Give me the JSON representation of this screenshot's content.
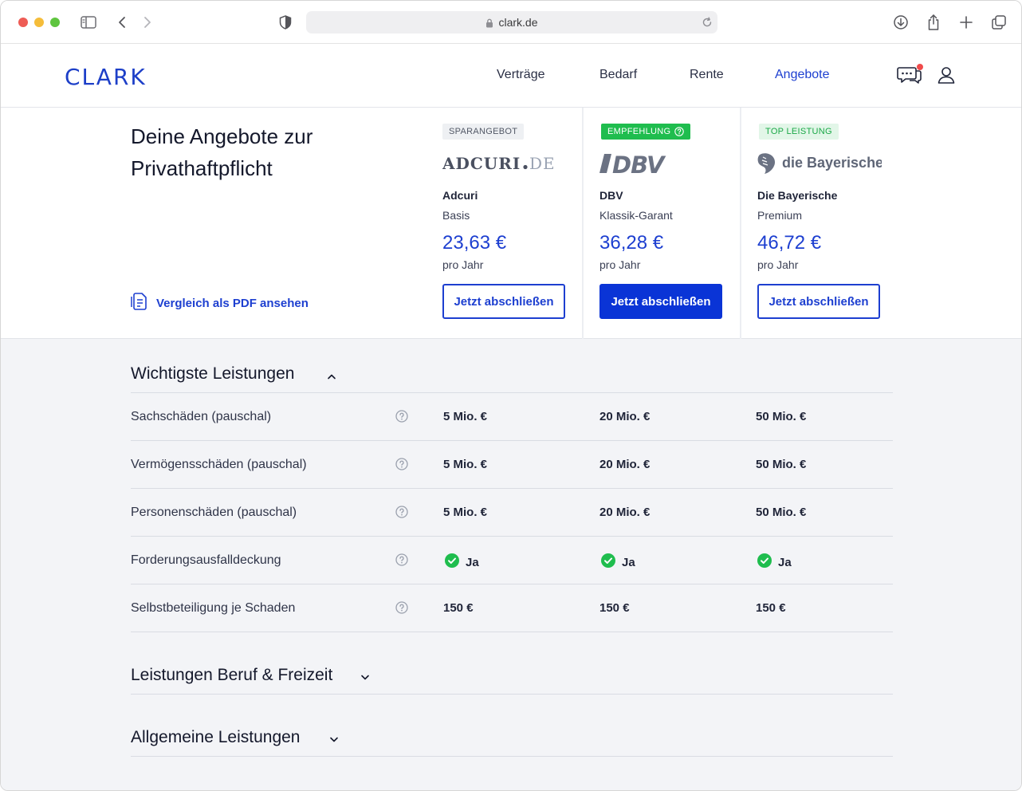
{
  "browser": {
    "url": "clark.de"
  },
  "header": {
    "logo": "CLARK",
    "nav": [
      {
        "label": "Verträge"
      },
      {
        "label": "Bedarf"
      },
      {
        "label": "Rente"
      },
      {
        "label": "Angebote"
      }
    ],
    "active_nav": "Angebote",
    "accent_color": "#1d3fd0"
  },
  "offers": {
    "title": "Deine Angebote zur Privathaftpflicht",
    "pdf_link": "Vergleich als PDF ansehen",
    "items": [
      {
        "badge": "SPARANGEBOT",
        "logo_text": "ADCURI.DE",
        "name": "Adcuri",
        "tariff": "Basis",
        "price": "23,63 €",
        "period": "pro Jahr",
        "cta": "Jetzt abschließen"
      },
      {
        "badge": "EMPFEHLUNG",
        "logo_text": "DBV",
        "name": "DBV",
        "tariff": "Klassik-Garant",
        "price": "36,28 €",
        "period": "pro Jahr",
        "cta": "Jetzt abschließen"
      },
      {
        "badge": "TOP LEISTUNG",
        "logo_text": "die Bayerische",
        "name": "Die Bayerische",
        "tariff": "Premium",
        "price": "46,72 €",
        "period": "pro Jahr",
        "cta": "Jetzt abschließen"
      }
    ]
  },
  "comparison": {
    "sections": [
      {
        "title": "Wichtigste Leistungen",
        "expanded": true
      },
      {
        "title": "Leistungen Beruf & Freizeit",
        "expanded": false
      },
      {
        "title": "Allgemeine Leistungen",
        "expanded": false
      }
    ],
    "rows": [
      {
        "label": "Sachschäden (pauschal)",
        "values": [
          "5 Mio. €",
          "20 Mio. €",
          "50 Mio. €"
        ]
      },
      {
        "label": "Vermögensschäden (pauschal)",
        "values": [
          "5 Mio. €",
          "20 Mio. €",
          "50 Mio. €"
        ]
      },
      {
        "label": "Personenschäden (pauschal)",
        "values": [
          "5 Mio. €",
          "20 Mio. €",
          "50 Mio. €"
        ]
      },
      {
        "label": "Forderungsausfalldeckung",
        "values": [
          "Ja",
          "Ja",
          "Ja"
        ]
      },
      {
        "label": "Selbstbeteiligung je Schaden",
        "values": [
          "150 €",
          "150 €",
          "150 €"
        ]
      }
    ]
  }
}
